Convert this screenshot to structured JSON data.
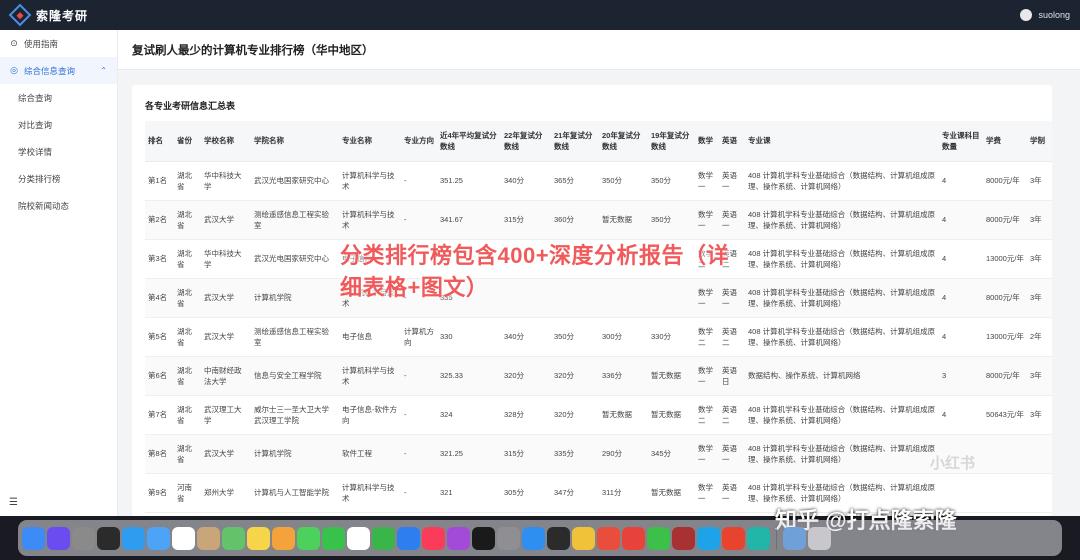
{
  "app": {
    "brand": "索隆考研",
    "user": "suolong",
    "page_title": "复试刷人最少的计算机专业排行榜（华中地区）"
  },
  "sidebar": {
    "items": [
      {
        "label": "使用指南",
        "icon": "help-circle-icon"
      },
      {
        "label": "综合信息查询",
        "icon": "search-icon",
        "expanded": true
      }
    ],
    "subitems": [
      "综合查询",
      "对比查询",
      "学校详情",
      "分类排行榜",
      "院校新闻动态"
    ],
    "footer_icon": "menu-icon"
  },
  "table": {
    "title": "各专业考研信息汇总表",
    "headers": [
      "排名",
      "省份",
      "学校名称",
      "学院名称",
      "专业名称",
      "专业方向",
      "近4年平均复试分数线",
      "22年复试分数线",
      "21年复试分数线",
      "20年复试分数线",
      "19年复试分数线",
      "数学",
      "英语",
      "专业课",
      "专业课科目数量",
      "学费",
      "学制"
    ],
    "rows": [
      [
        "第1名",
        "湖北省",
        "华中科技大学",
        "武汉光电国家研究中心",
        "计算机科学与技术",
        "-",
        "351.25",
        "340分",
        "365分",
        "350分",
        "350分",
        "数学一",
        "英语一",
        "408 计算机学科专业基础综合（数据结构、计算机组成原理、操作系统、计算机网络）",
        "4",
        "8000元/年",
        "3年"
      ],
      [
        "第2名",
        "湖北省",
        "武汉大学",
        "测绘遥感信息工程实验室",
        "计算机科学与技术",
        "-",
        "341.67",
        "315分",
        "360分",
        "暂无数据",
        "350分",
        "数学一",
        "英语一",
        "408 计算机学科专业基础综合（数据结构、计算机组成原理、操作系统、计算机网络）",
        "4",
        "8000元/年",
        "3年"
      ],
      [
        "第3名",
        "湖北省",
        "华中科技大学",
        "武汉光电国家研究中心",
        "电子信息",
        "-",
        "",
        "",
        "",
        "",
        "",
        "数学二",
        "英语二",
        "408 计算机学科专业基础综合（数据结构、计算机组成原理、操作系统、计算机网络）",
        "4",
        "13000元/年",
        "3年"
      ],
      [
        "第4名",
        "湖北省",
        "武汉大学",
        "计算机学院",
        "计算机科学与技术",
        "-",
        "335",
        "",
        "",
        "",
        "",
        "数学一",
        "英语一",
        "408 计算机学科专业基础综合（数据结构、计算机组成原理、操作系统、计算机网络）",
        "4",
        "8000元/年",
        "3年"
      ],
      [
        "第5名",
        "湖北省",
        "武汉大学",
        "测绘遥感信息工程实验室",
        "电子信息",
        "计算机方向",
        "330",
        "340分",
        "350分",
        "300分",
        "330分",
        "数学二",
        "英语二",
        "408 计算机学科专业基础综合（数据结构、计算机组成原理、操作系统、计算机网络）",
        "4",
        "13000元/年",
        "2年"
      ],
      [
        "第6名",
        "湖北省",
        "中南财经政法大学",
        "信息与安全工程学院",
        "计算机科学与技术",
        "-",
        "325.33",
        "320分",
        "320分",
        "336分",
        "暂无数据",
        "数学一",
        "英语日",
        "数据结构、操作系统、计算机网络",
        "3",
        "8000元/年",
        "3年"
      ],
      [
        "第7名",
        "湖北省",
        "武汉理工大学",
        "威尔士三一圣大卫大学武汉理工学院",
        "电子信息-软件方向",
        "-",
        "324",
        "328分",
        "320分",
        "暂无数据",
        "暂无数据",
        "数学二",
        "英语二",
        "408 计算机学科专业基础综合（数据结构、计算机组成原理、操作系统、计算机网络）",
        "4",
        "50643元/年",
        "3年"
      ],
      [
        "第8名",
        "湖北省",
        "武汉大学",
        "计算机学院",
        "软件工程",
        "-",
        "321.25",
        "315分",
        "335分",
        "290分",
        "345分",
        "数学一",
        "英语一",
        "408 计算机学科专业基础综合（数据结构、计算机组成原理、操作系统、计算机网络）",
        "",
        "",
        ""
      ],
      [
        "第9名",
        "河南省",
        "郑州大学",
        "计算机与人工智能学院",
        "计算机科学与技术",
        "-",
        "321",
        "305分",
        "347分",
        "311分",
        "暂无数据",
        "数学一",
        "英语一",
        "408 计算机学科专业基础综合（数据结构、计算机组成原理、操作系统、计算机网络）",
        "",
        "",
        ""
      ]
    ]
  },
  "overlay": {
    "text": "分类排行榜包含400+深度分析报告（详细表格+图文）",
    "watermark_small": "小红书",
    "watermark_credit": "知乎 @打点隆索隆",
    "color": "#f05a5a"
  },
  "dock": {
    "apps": [
      {
        "name": "finder-icon",
        "color": "#3d8bf7"
      },
      {
        "name": "siri-icon",
        "color": "#6a4cf0"
      },
      {
        "name": "launchpad-icon",
        "color": "#8a8a8a"
      },
      {
        "name": "terminal-icon",
        "color": "#2b2b2b"
      },
      {
        "name": "safari-icon",
        "color": "#2f9cf0"
      },
      {
        "name": "mail-icon",
        "color": "#4da3f5"
      },
      {
        "name": "calendar-icon",
        "color": "#ffffff"
      },
      {
        "name": "contacts-icon",
        "color": "#c9a57a"
      },
      {
        "name": "maps-icon",
        "color": "#63c36a"
      },
      {
        "name": "notes-icon",
        "color": "#f7d54a"
      },
      {
        "name": "photos-icon",
        "color": "#f3a23c"
      },
      {
        "name": "messages-icon",
        "color": "#4cd25c"
      },
      {
        "name": "facetime-icon",
        "color": "#39c24b"
      },
      {
        "name": "reminders-icon",
        "color": "#ffffff"
      },
      {
        "name": "numbers-icon",
        "color": "#39b54a"
      },
      {
        "name": "keynote-icon",
        "color": "#2f7ef0"
      },
      {
        "name": "music-icon",
        "color": "#fa3c5a"
      },
      {
        "name": "podcasts-icon",
        "color": "#a24bd8"
      },
      {
        "name": "tv-icon",
        "color": "#1a1a1a"
      },
      {
        "name": "system-settings-icon",
        "color": "#8e8e93"
      },
      {
        "name": "app-store-icon",
        "color": "#2f8ff0"
      },
      {
        "name": "chatgpt-icon",
        "color": "#2b2b2b"
      },
      {
        "name": "chrome-icon",
        "color": "#f0c23a"
      },
      {
        "name": "xmind-icon",
        "color": "#e94d3c"
      },
      {
        "name": "wps-icon",
        "color": "#e8433b"
      },
      {
        "name": "wechat-icon",
        "color": "#3cc04a"
      },
      {
        "name": "dictionary-icon",
        "color": "#a83232"
      },
      {
        "name": "webstorm-icon",
        "color": "#1fa3e8"
      },
      {
        "name": "intellij-icon",
        "color": "#e8432f"
      },
      {
        "name": "datagrip-icon",
        "color": "#21b6a8"
      },
      {
        "name": "preview-icon",
        "color": "#6fa0d8"
      },
      {
        "name": "trash-icon",
        "color": "#c7c7cc"
      }
    ]
  }
}
